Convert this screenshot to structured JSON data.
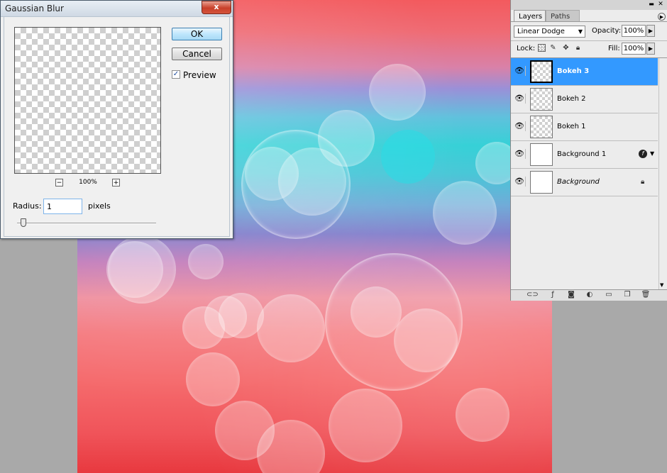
{
  "dialog": {
    "title": "Gaussian Blur",
    "close_glyph": "x",
    "ok_label": "OK",
    "cancel_label": "Cancel",
    "preview_label": "Preview",
    "preview_checked": true,
    "zoom_percent": "100%",
    "zoom_out_glyph": "−",
    "zoom_in_glyph": "+",
    "radius_label": "Radius:",
    "radius_value": "1",
    "radius_units": "pixels"
  },
  "layers_panel": {
    "tabs": [
      {
        "label": "Layers",
        "active": true
      },
      {
        "label": "Paths",
        "active": false
      }
    ],
    "blend_mode": "Linear Dodge",
    "opacity_label": "Opacity:",
    "opacity_value": "100%",
    "lock_label": "Lock:",
    "fill_label": "Fill:",
    "fill_value": "100%",
    "layers": [
      {
        "name": "Bokeh 3",
        "selected": true,
        "thumb": "transparent",
        "visible": true
      },
      {
        "name": "Bokeh 2",
        "selected": false,
        "thumb": "transparent",
        "visible": true
      },
      {
        "name": "Bokeh 1",
        "selected": false,
        "thumb": "transparent",
        "visible": true
      },
      {
        "name": "Background 1",
        "selected": false,
        "thumb": "white",
        "visible": true,
        "has_effects": true
      },
      {
        "name": "Background",
        "selected": false,
        "thumb": "white",
        "visible": true,
        "locked": true,
        "italic": true
      }
    ],
    "bottom_icons": [
      "link-layers-icon",
      "layer-style-icon",
      "layer-mask-icon",
      "adjustment-layer-icon",
      "group-icon",
      "new-layer-icon",
      "trash-icon"
    ]
  },
  "colors": {
    "selection": "#3399ff",
    "canvas_top": "#f35a5e",
    "canvas_cyan": "#32d0d6",
    "canvas_violet": "#7d79c9",
    "canvas_bottom": "#e8393f"
  }
}
